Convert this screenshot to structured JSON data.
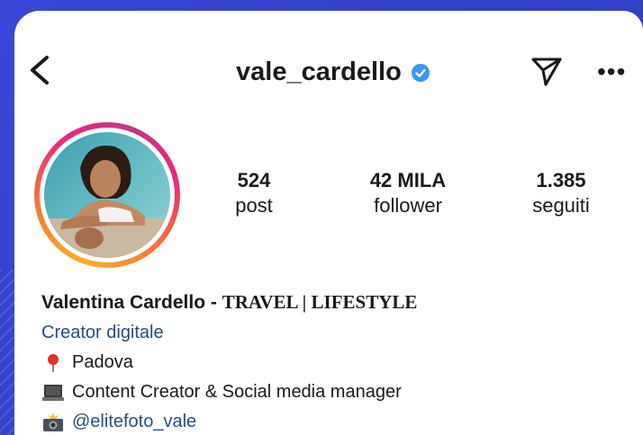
{
  "header": {
    "username": "vale_cardello",
    "verified": true
  },
  "stats": [
    {
      "value": "524",
      "label": "post"
    },
    {
      "value": "42 MILA",
      "label": "follower"
    },
    {
      "value": "1.385",
      "label": "seguiti"
    }
  ],
  "profile": {
    "name": "Valentina Cardello - ",
    "name_tagline": "TRAVEL | LIFESTYLE",
    "category": "Creator digitale",
    "bio_lines": [
      {
        "icon": "pin-icon",
        "text": "Padova"
      },
      {
        "icon": "laptop-icon",
        "text": "Content Creator & Social media manager"
      },
      {
        "icon": "camera-flash-icon",
        "text": "@elitefoto_vale"
      }
    ]
  },
  "colors": {
    "background": "#3340c8",
    "verified_badge": "#3897f0",
    "link": "#2a4d7e",
    "story_ring": [
      "#f9b32b",
      "#ee2a7b",
      "#c13584"
    ]
  }
}
